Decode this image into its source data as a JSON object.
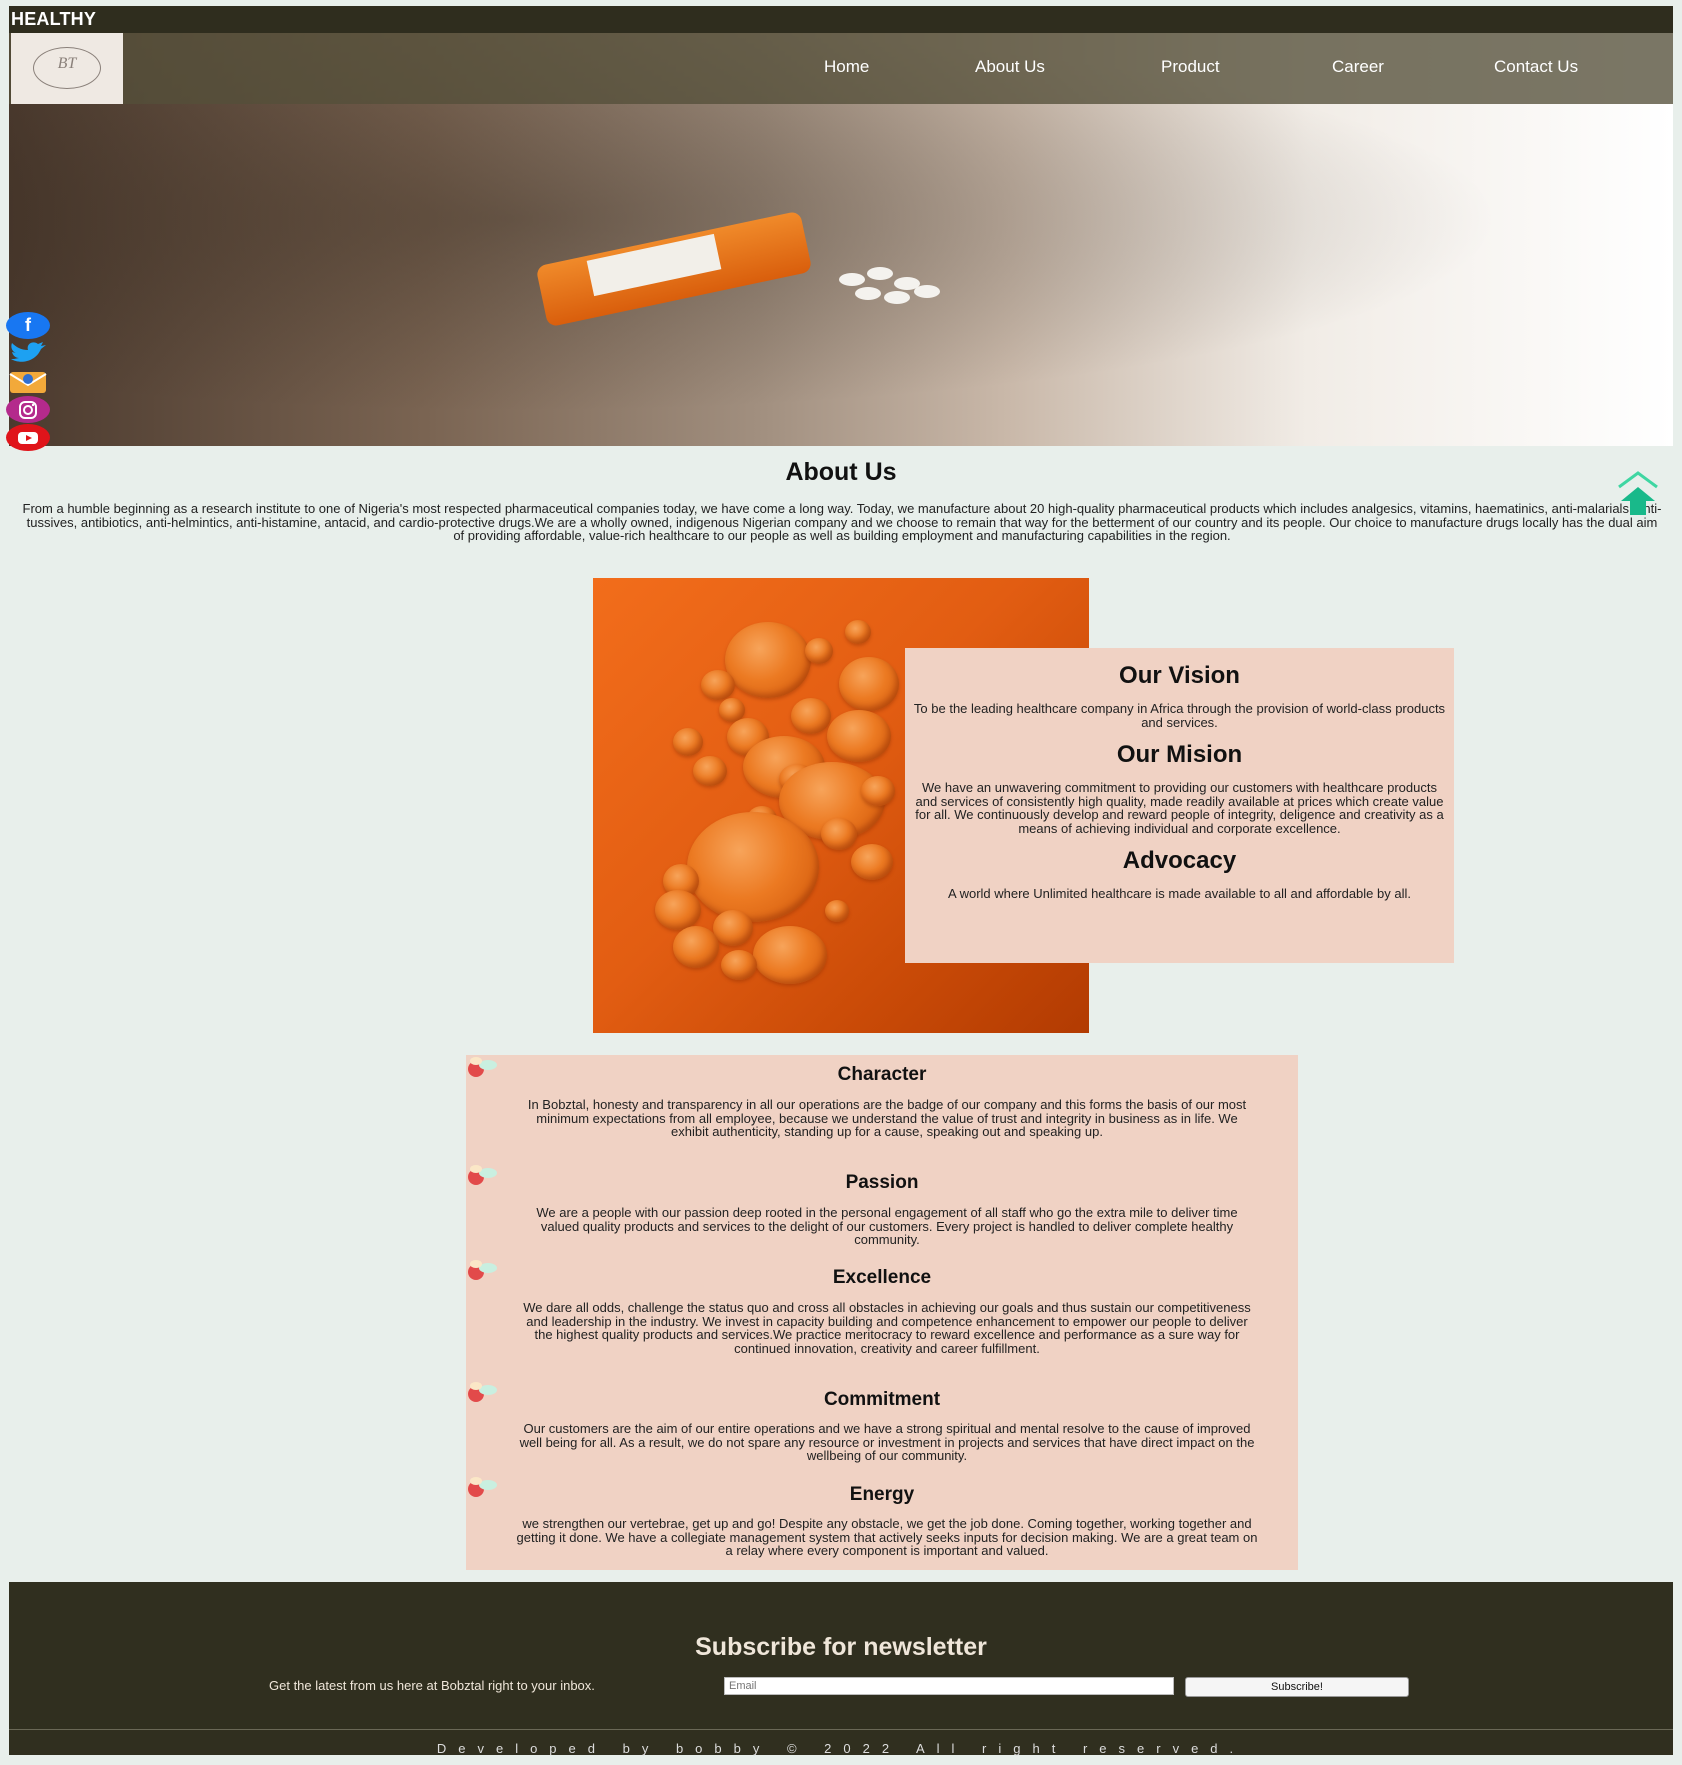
{
  "brand": "HEALTHY",
  "logo_text": "BT",
  "nav": [
    "Home",
    "About Us",
    "Product",
    "Career",
    "Contact Us"
  ],
  "social": [
    "facebook-icon",
    "twitter-icon",
    "email-icon",
    "instagram-icon",
    "youtube-icon"
  ],
  "about": {
    "title": "About Us",
    "text": "From a humble beginning as a research institute to one of Nigeria's most respected pharmaceutical companies today, we have come a long way. Today, we manufacture about 20 high-quality pharmaceutical products which includes analgesics, vitamins, haematinics, anti-malarials, anti-tussives, antibiotics, anti-helmintics, anti-histamine, antacid, and cardio-protective drugs.We are a wholly owned, indigenous Nigerian company and we choose to remain that way for the betterment of our country and its people. Our choice to manufacture drugs locally has the dual aim of providing affordable, value-rich healthcare to our people as well as building employment and manufacturing capabilities in the region."
  },
  "vision": {
    "vision_title": "Our Vision",
    "vision_text": "To be the leading healthcare company in Africa through the provision of world-class products and services.",
    "mission_title": "Our Mision",
    "mission_text": "We have an unwavering commitment to providing our customers with healthcare products and services of consistently high quality, made readily available at prices which create value for all. We continuously develop and reward people of integrity, deligence and creativity as a means of achieving individual and corporate excellence.",
    "advocacy_title": "Advocacy",
    "advocacy_text": "A world where Unlimited healthcare is made available to all and affordable by all."
  },
  "values": [
    {
      "title": "Character",
      "text": "In Bobztal, honesty and transparency in all our operations are the badge of our company and this forms the basis of our most minimum expectations from all employee, because we understand the value of trust and integrity in business as in life. We exhibit authenticity, standing up for a cause, speaking out and speaking up."
    },
    {
      "title": "Passion",
      "text": "We are a people with our passion deep rooted in the personal engagement of all staff who go the extra mile to deliver time valued quality products and services to the delight of our customers. Every project is handled to deliver complete healthy community."
    },
    {
      "title": "Excellence",
      "text": "We dare all odds, challenge the status quo and cross all obstacles in achieving our goals and thus sustain our competitiveness and leadership in the industry. We invest in capacity building and competence enhancement to empower our people to deliver the highest quality products and services.We practice meritocracy to reward excellence and performance as a sure way for continued innovation, creativity and career fulfillment."
    },
    {
      "title": "Commitment",
      "text": "Our customers are the aim of our entire operations and we have a strong spiritual and mental resolve to the cause of improved well being for all. As a result, we do not spare any resource or investment in projects and services that have direct impact on the wellbeing of our community."
    },
    {
      "title": "Energy",
      "text": "we strengthen our vertebrae, get up and go! Despite any obstacle, we get the job done. Coming together, working together and getting it done. We have a collegiate management system that actively seeks inputs for decision making. We are a great team on a relay where every component is important and valued."
    }
  ],
  "newsletter": {
    "title": "Subscribe for newsletter",
    "text": "Get the latest from us here at Bobztal right to your inbox.",
    "email_placeholder": "Email",
    "button": "Subscribe!"
  },
  "credits": "Developed by bobby © 2022 All right reserved."
}
